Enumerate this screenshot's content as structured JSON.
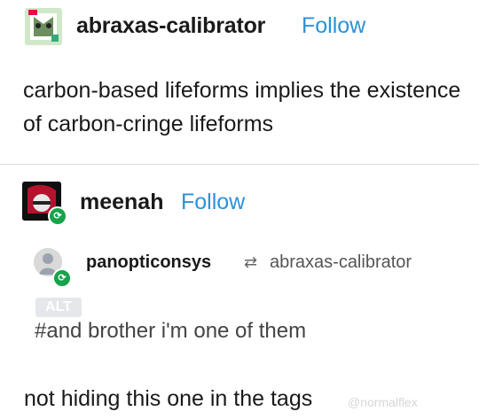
{
  "post1": {
    "username": "abraxas-calibrator",
    "follow": "Follow",
    "text": "carbon-based lifeforms implies the existence of carbon-cringe lifeforms"
  },
  "post2": {
    "username": "meenah",
    "follow": "Follow",
    "reblogged_from_user": "panopticonsys",
    "reblog_source": "abraxas-calibrator",
    "alt_badge": "ALT",
    "tags": "#and brother i'm one of them",
    "comment": "not hiding this one in the tags"
  },
  "watermark": "@normalflex",
  "colors": {
    "follow": "#2a92d7",
    "reblog_badge": "#16a34a"
  }
}
